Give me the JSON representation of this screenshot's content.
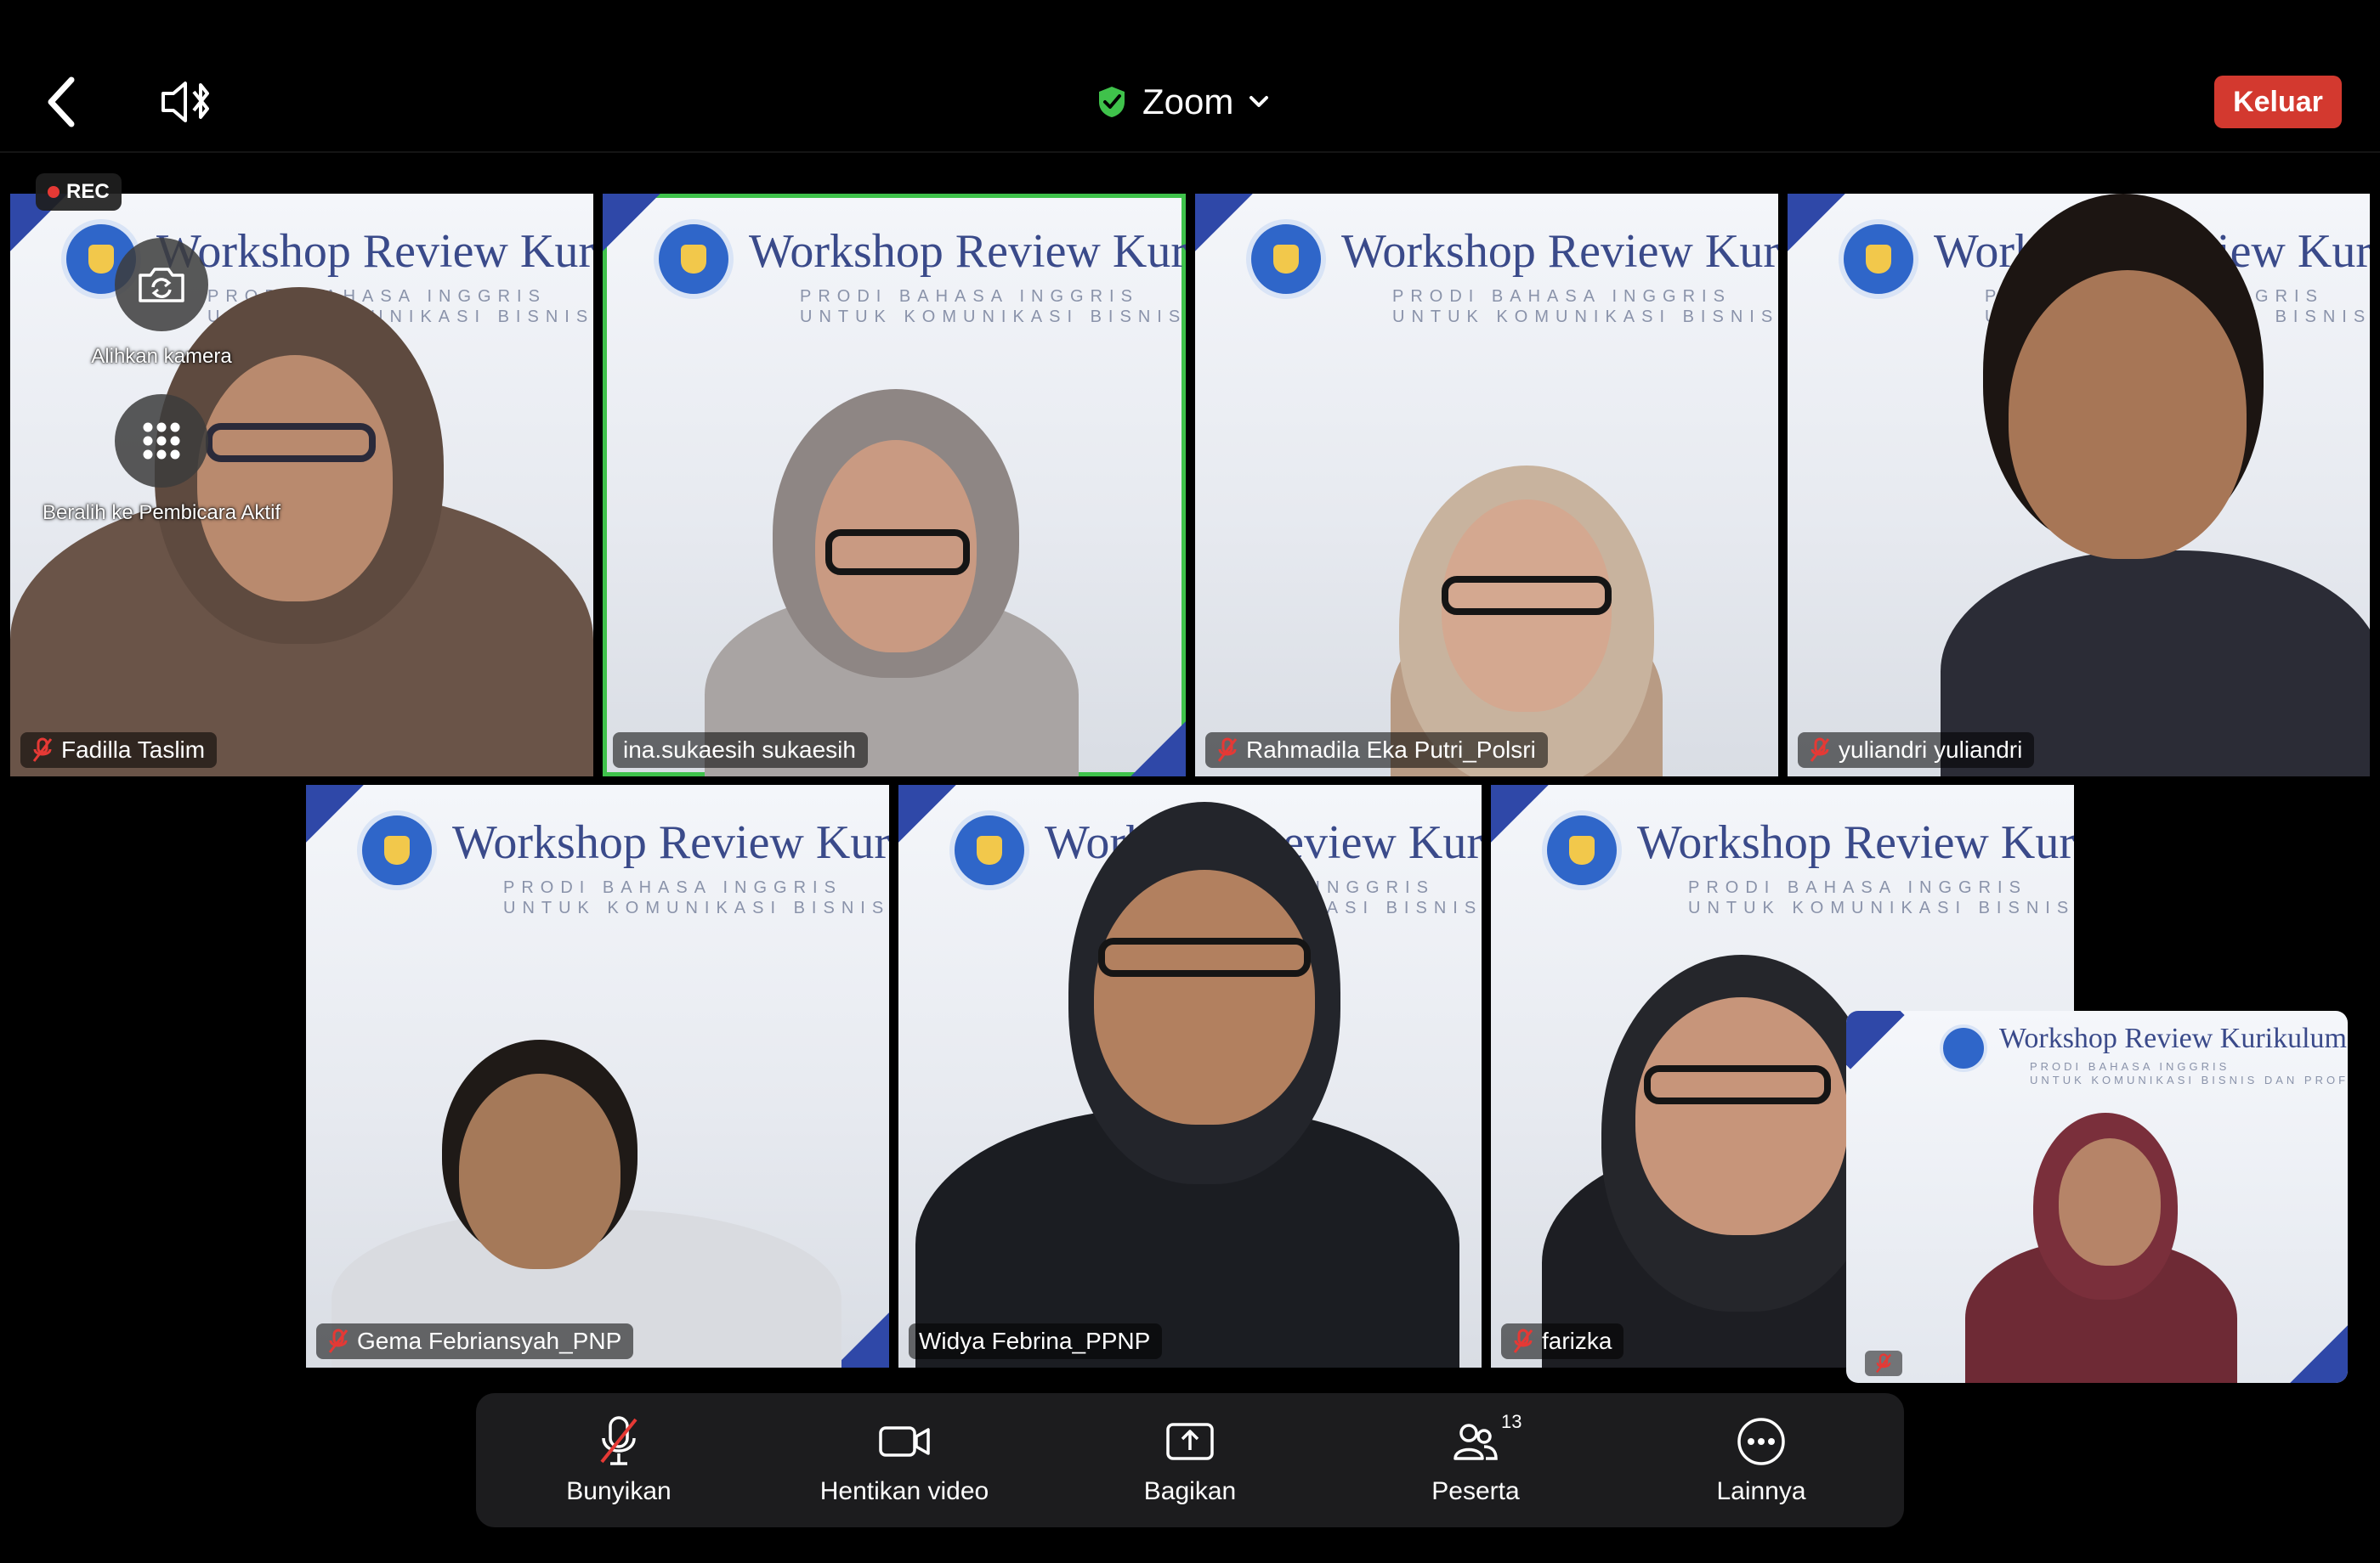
{
  "header": {
    "title": "Zoom",
    "leave_label": "Keluar",
    "accent_color": "#d3392f",
    "secure_color": "#3fc24b"
  },
  "recording": {
    "label": "REC"
  },
  "floating_controls": {
    "switch_camera_label": "Alihkan kamera",
    "switch_view_label": "Beralih ke Pembicara Aktif"
  },
  "banner": {
    "title": "Workshop Review Kuri",
    "line1": "PRODI BAHASA INGGRIS",
    "line2": "UNTUK KOMUNIKASI BISNIS DAN"
  },
  "participants": [
    {
      "name": "Fadilla Taslim",
      "muted": true,
      "active": false
    },
    {
      "name": "ina.sukaesih sukaesih",
      "muted": false,
      "active": true
    },
    {
      "name": "Rahmadila Eka Putri_Polsri",
      "muted": true,
      "active": false
    },
    {
      "name": "yuliandri yuliandri",
      "muted": true,
      "active": false
    },
    {
      "name": "Gema Febriansyah_PNP",
      "muted": true,
      "active": false
    },
    {
      "name": "Widya Febrina_PPNP",
      "muted": false,
      "active": false
    },
    {
      "name": "farizka",
      "muted": true,
      "active": false
    }
  ],
  "self_view": {
    "banner_title": "Workshop Review Kurikulum",
    "line1": "PRODI BAHASA INGGRIS",
    "line2": "UNTUK KOMUNIKASI BISNIS DAN PROFE",
    "muted": true
  },
  "toolbar": {
    "unmute_label": "Bunyikan",
    "stop_video_label": "Hentikan video",
    "share_label": "Bagikan",
    "participants_label": "Peserta",
    "participants_count": "13",
    "more_label": "Lainnya"
  }
}
